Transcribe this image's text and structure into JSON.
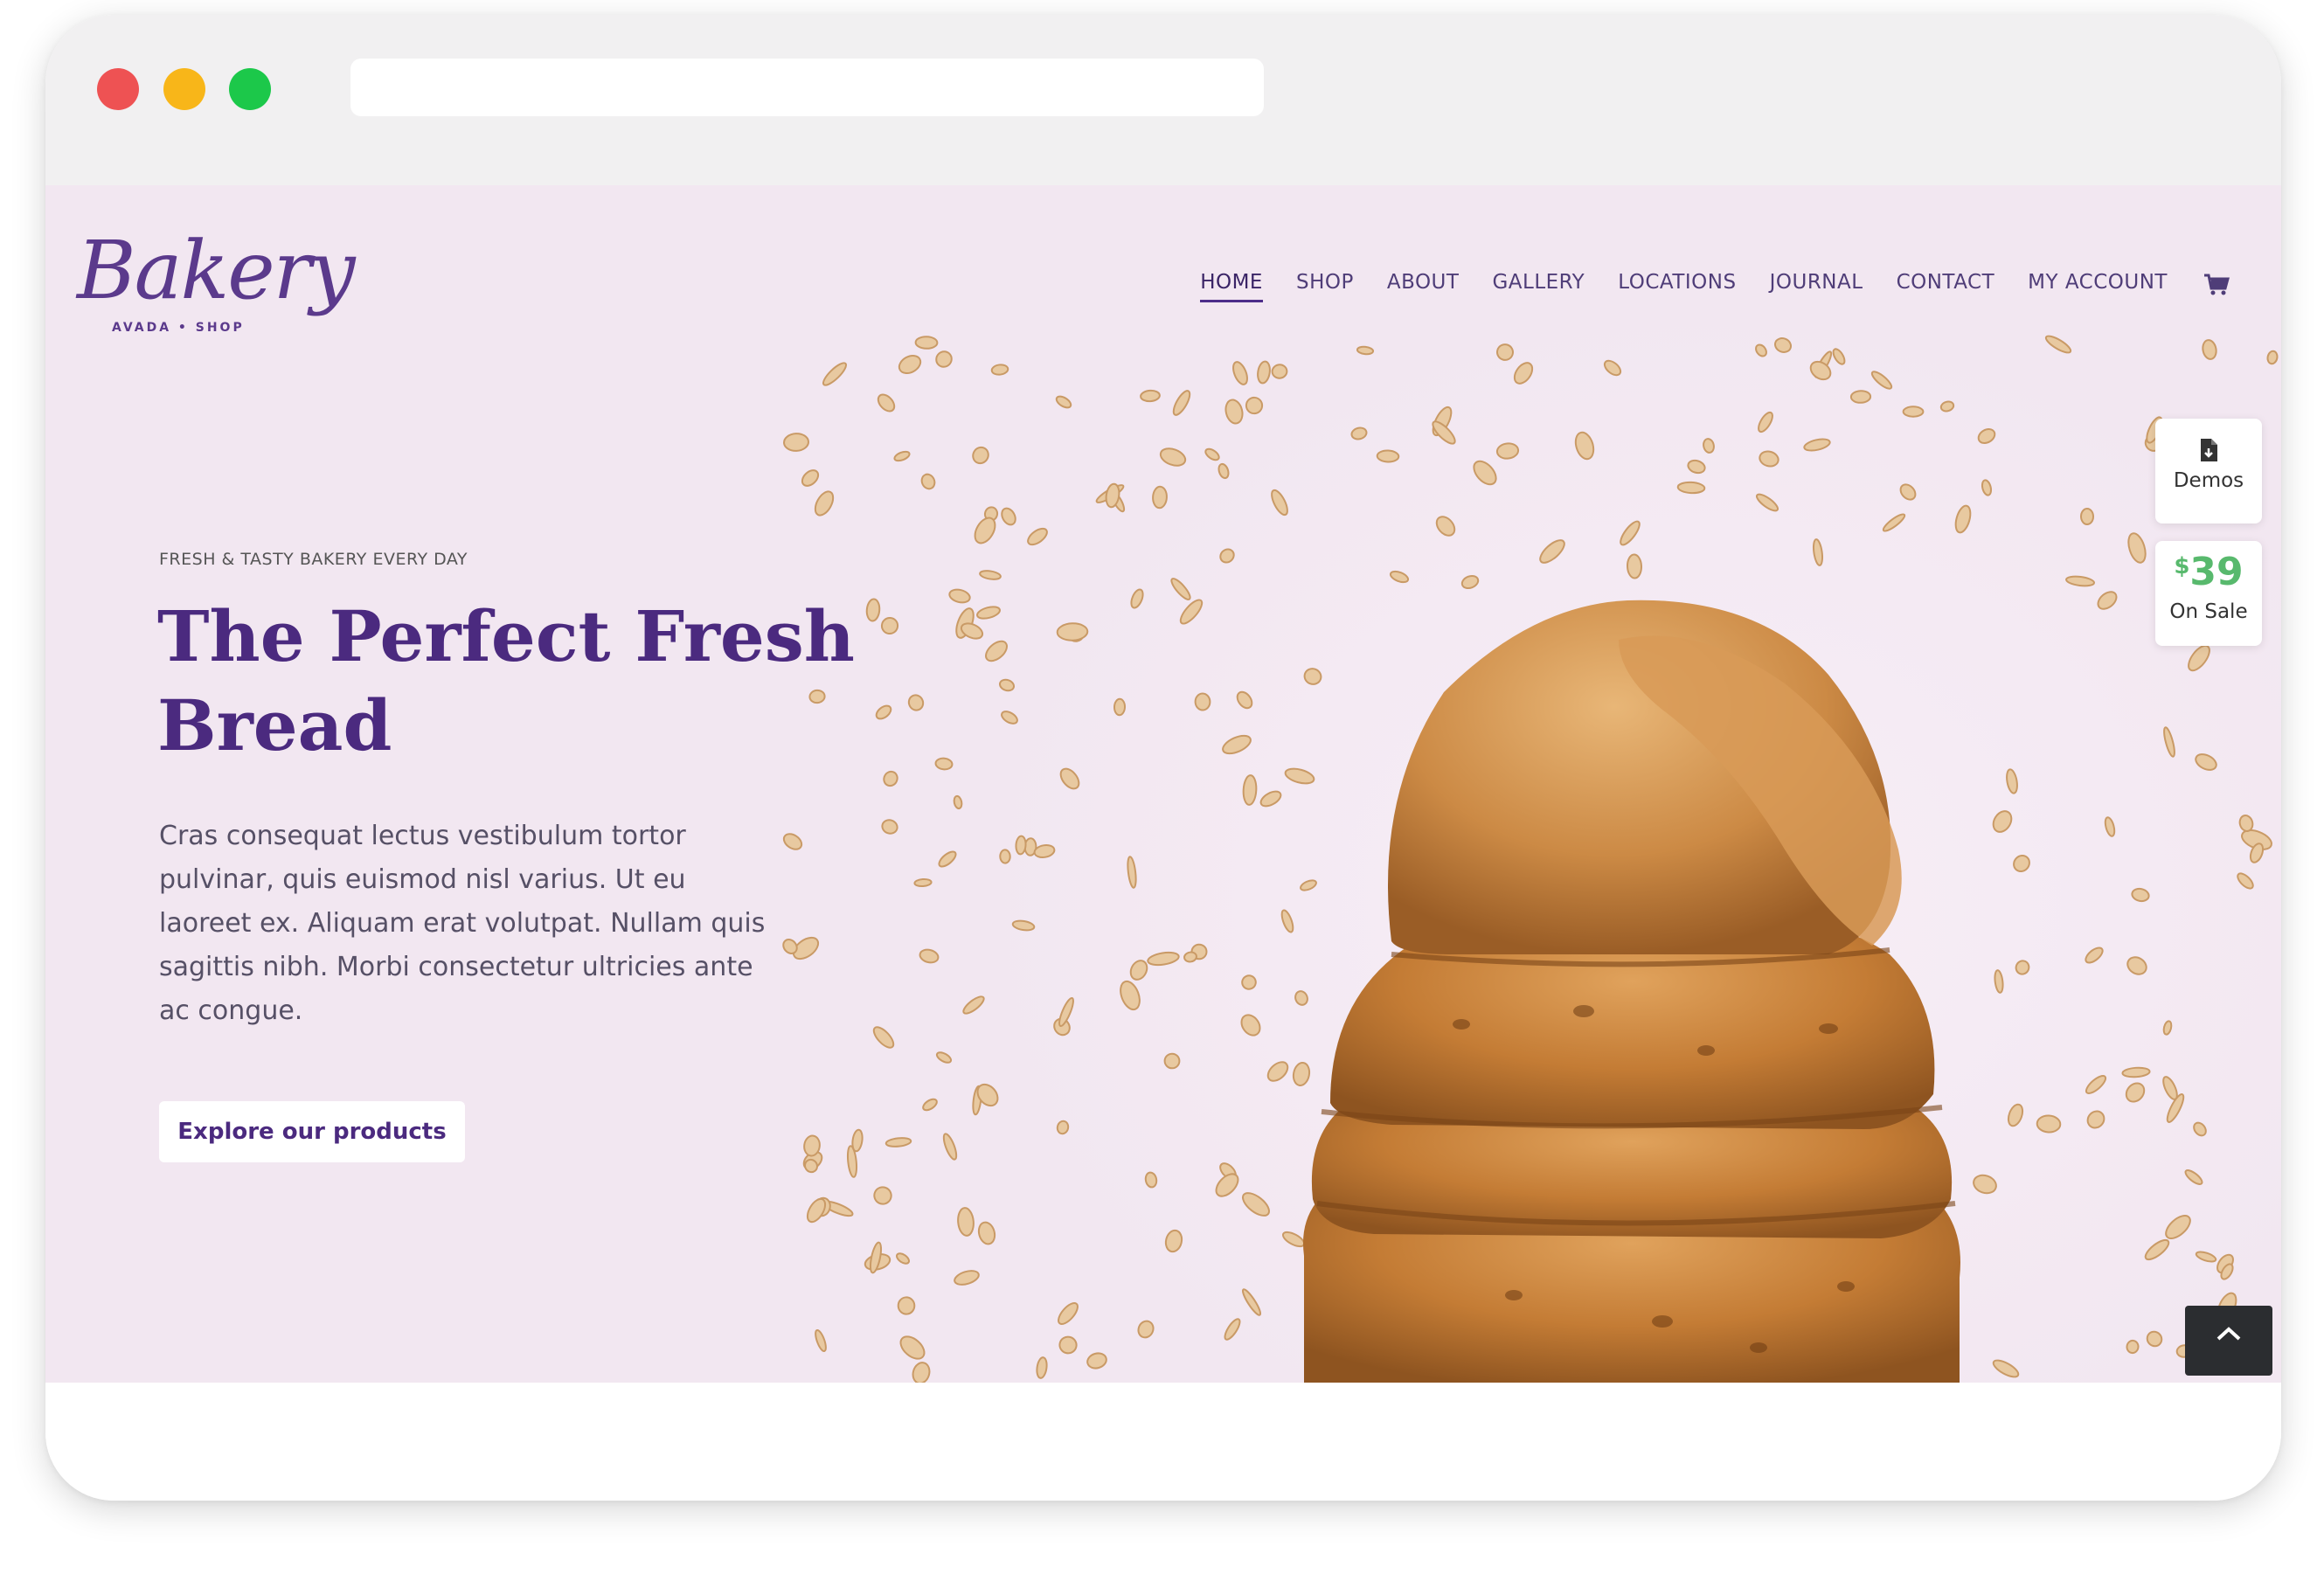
{
  "brand": {
    "logo_script": "Bakery",
    "logo_tagline": "AVADA • SHOP"
  },
  "nav": {
    "items": [
      {
        "label": "HOME",
        "active": true
      },
      {
        "label": "SHOP"
      },
      {
        "label": "ABOUT"
      },
      {
        "label": "GALLERY"
      },
      {
        "label": "LOCATIONS"
      },
      {
        "label": "JOURNAL"
      },
      {
        "label": "CONTACT"
      },
      {
        "label": "MY ACCOUNT"
      }
    ],
    "cart_icon": "cart-icon"
  },
  "side_widgets": {
    "demos_label": "Demos",
    "demos_icon": "file-icon",
    "price_currency": "$",
    "price_amount": "39",
    "sale_label": "On Sale"
  },
  "hero": {
    "eyebrow": "FRESH & TASTY BAKERY EVERY DAY",
    "headline_line1": "The Perfect Fresh",
    "headline_line2": "Bread",
    "body_lines": [
      "Cras consequat lectus vestibulum tortor",
      "pulvinar, quis euismod nisl varius. Ut eu",
      "laoreet ex. Aliquam erat volutpat. Nullam quis",
      "sagittis nibh. Morbi consectetur ultricies ante",
      "ac congue."
    ],
    "cta_label": "Explore our products"
  },
  "colors": {
    "page_background": "#f2e7f1",
    "brand_purple": "#4b2a7f",
    "sale_green": "#58b96d",
    "to_top_bg": "#2b2d30"
  }
}
